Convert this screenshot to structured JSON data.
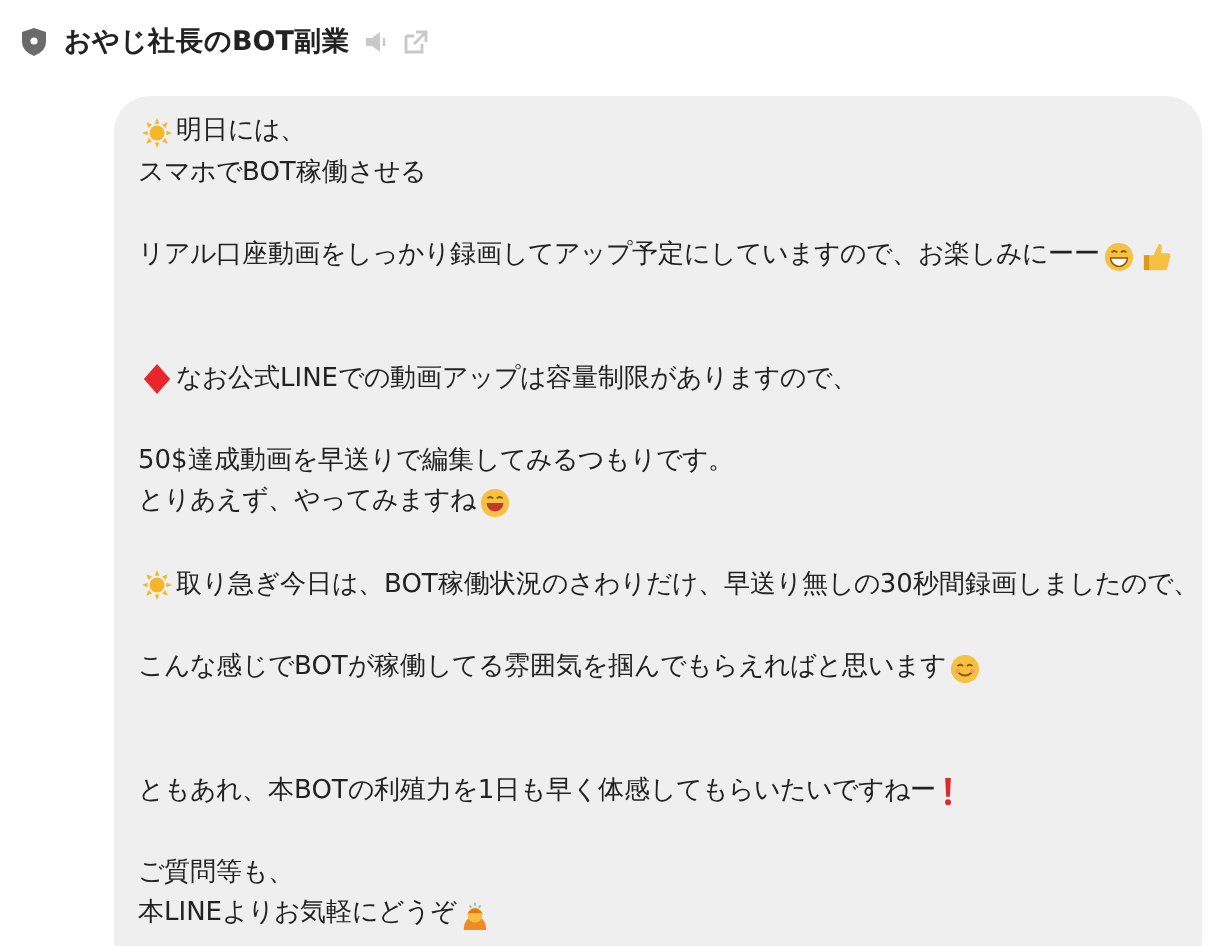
{
  "header": {
    "title": "おやじ社長のBOT副業"
  },
  "message": {
    "blocks": [
      {
        "kind": "first",
        "lines": [
          {
            "text": "明日には、",
            "lead": {
              "kind": "sun"
            }
          },
          {
            "text": "スマホでBOT稼働させる"
          }
        ]
      },
      {
        "kind": "gap",
        "lines": [
          {
            "text": "リアル口座動画をしっかり録画してアップ予定にしていますので、お楽しみにーー",
            "trail": [
              {
                "kind": "grin"
              },
              {
                "kind": "thumbs"
              }
            ]
          }
        ]
      },
      {
        "kind": "wide-gap",
        "lines": [
          {
            "text": "なお公式LINEでの動画アップは容量制限がありますので、",
            "lead": {
              "kind": "diamond"
            }
          }
        ]
      },
      {
        "kind": "gap",
        "lines": [
          {
            "text": "50$達成動画を早送りで編集してみるつもりです。"
          },
          {
            "text": "とりあえず、やってみますね",
            "trail": [
              {
                "kind": "laugh"
              }
            ]
          }
        ]
      },
      {
        "kind": "gap",
        "lines": [
          {
            "text": "取り急ぎ今日は、BOT稼働状況のさわりだけ、早送り無しの30秒間録画しましたので、",
            "lead": {
              "kind": "sun"
            }
          }
        ]
      },
      {
        "kind": "gap",
        "lines": [
          {
            "text": "こんな感じでBOTが稼働してる雰囲気を掴んでもらえればと思います",
            "trail": [
              {
                "kind": "smile"
              }
            ]
          }
        ]
      },
      {
        "kind": "wide-gap",
        "lines": [
          {
            "text": "ともあれ、本BOTの利殖力を1日も早く体感してもらいたいですねー",
            "trail": [
              {
                "kind": "exclaim"
              }
            ]
          }
        ]
      },
      {
        "kind": "gap",
        "lines": [
          {
            "text": "ご質問等も、"
          },
          {
            "text": "本LINEよりお気軽にどうぞ",
            "trail": [
              {
                "kind": "bow"
              }
            ]
          }
        ]
      }
    ]
  }
}
